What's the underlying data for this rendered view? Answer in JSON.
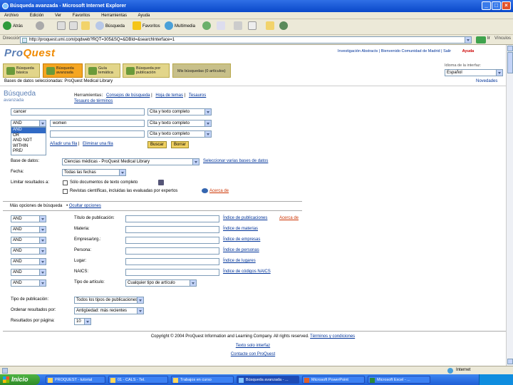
{
  "window": {
    "title": "Búsqueda avanzada - Microsoft Internet Explorer",
    "minimize": "_",
    "maximize": "□",
    "close": "×"
  },
  "menu": [
    "Archivo",
    "Edición",
    "Ver",
    "Favoritos",
    "Herramientas",
    "Ayuda"
  ],
  "toolbar": {
    "back": "Atrás",
    "search": "Búsqueda",
    "favorites": "Favoritos",
    "multimedia": "Multimedia"
  },
  "address": {
    "label": "Dirección",
    "url": "http://proquest.umi.com/pqdweb?RQT=305&SQ=&DBId=&searchInterface=1",
    "go": "Ir",
    "links": "Vínculos"
  },
  "header": {
    "logo_pro": "Pro",
    "logo_quest": "Quest",
    "toplinks": "Investigación Abstracts | Bienvenido Comunidad de Madrid | Salir",
    "help": "Ayuda",
    "interface_label": "Idioma de la interfaz:",
    "interface_value": "Español"
  },
  "tabs": [
    {
      "label": "Búsqueda básica"
    },
    {
      "label": "Búsqueda avanzada"
    },
    {
      "label": "Guía temática"
    },
    {
      "label": "Búsqueda por publicación"
    },
    {
      "label": "Mis búsquedas (0 artículos)"
    }
  ],
  "database_line": "Bases de datos seleccionadas: ProQuest Medical Library",
  "whats_new": "Novedades",
  "page_title": "Búsqueda",
  "page_subtitle": "avanzada",
  "tools": {
    "label": "Herramientas:",
    "link1": "Consejos de búsqueda",
    "link2": "Hoja de temas",
    "link3": "Tesauros",
    "link4": "Tesauro de términos"
  },
  "search_rows": [
    {
      "term": "cancer",
      "field": "Cita y texto completo"
    },
    {
      "op": "AND",
      "term": "women",
      "field": "Cita y texto completo"
    },
    {
      "op": "",
      "term": "",
      "field": "Cita y texto completo"
    }
  ],
  "listbox_options": [
    "AND",
    "OR",
    "AND NOT",
    "WITHIN",
    "PRE/"
  ],
  "add_row": "Añadir una fila",
  "remove_row": "Eliminar una fila",
  "search_btn": "Buscar",
  "clear_btn": "Borrar",
  "db_label": "Base de datos:",
  "db_value": "Ciencias médicas - ProQuest Medical Library",
  "db_link": "Seleccionar varias bases de datos",
  "date_label": "Fecha:",
  "date_value": "Todas las fechas",
  "limit_label": "Limitar resultados a:",
  "limit_fulltext": "Sólo documentos de texto completo",
  "limit_scholarly": "Revistas científicas, incluidas las evaluadas por expertos",
  "about_link": "Acerca de",
  "sections": {
    "more": "Más opciones de búsqueda",
    "hide": "Ocultar opciones"
  },
  "more_rows": [
    {
      "op": "AND",
      "label": "Título de publicación:",
      "link": "Índice de publicaciones",
      "extra": "Acerca de"
    },
    {
      "op": "AND",
      "label": "Materia:",
      "link": "Índice de materias"
    },
    {
      "op": "AND",
      "label": "Empresa/org.:",
      "link": "Índice de empresas"
    },
    {
      "op": "AND",
      "label": "Persona:",
      "link": "Índice de personas"
    },
    {
      "op": "AND",
      "label": "Lugar:",
      "link": "Índice de lugares"
    },
    {
      "op": "AND",
      "label": "NAICS:",
      "link": "Índice de códigos NAICS"
    },
    {
      "op": "AND",
      "label": "Tipo de artículo:",
      "value": "Cualquier tipo de artículo"
    }
  ],
  "pubtype_label": "Tipo de publicación:",
  "pubtype_value": "Todos los tipos de publicaciones",
  "sort_label": "Ordenar resultados por:",
  "sort_value": "Antigüedad: más recientes",
  "perpage_label": "Resultados por página:",
  "perpage_value": "10",
  "footer": {
    "copyright": "Copyright © 2004 ProQuest Information and Learning Company. All rights reserved.",
    "terms": "Términos y condiciones",
    "line2": "Texto solo interfaz",
    "line3": "Contacte con ProQuest"
  },
  "status": {
    "zone": "Internet"
  },
  "taskbar": {
    "start": "Inicio",
    "items": [
      "PROQUEST - tutorial",
      "01 - CALS - Tel.",
      "Trabajos en curso",
      "Búsqueda avanzada - ...",
      "Microsoft PowerPoint",
      "Microsoft Excel - ..."
    ]
  }
}
